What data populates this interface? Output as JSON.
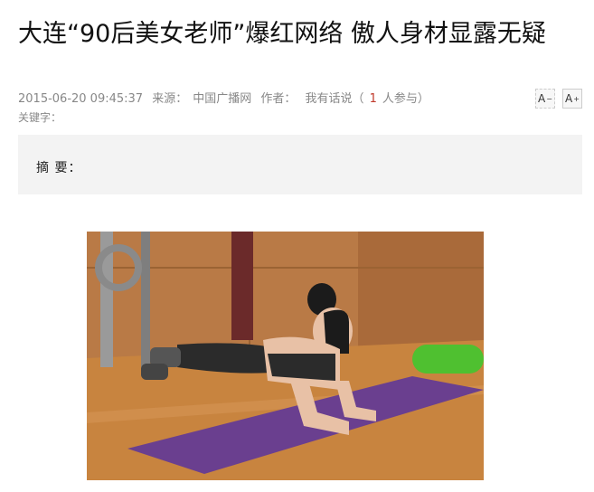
{
  "article": {
    "title": "大连“90后美女老师”爆红网络 傲人身材显露无疑",
    "date": "2015-06-20 09:45:37",
    "source_label": "来源：",
    "source": "中国广播网",
    "author_label": "作者：",
    "comments_prefix": "我有话说（",
    "comments_count": "1",
    "comments_suffix": "人参与）",
    "keywords_label": "关键字：",
    "summary_label": "摘 要："
  },
  "font_controls": {
    "decrease_label": "A",
    "decrease_mark": "−",
    "increase_label": "A",
    "increase_mark": "+"
  },
  "photo": {
    "icon": "photo-image",
    "colors": {
      "floor": "#c8843f",
      "wall": "#b97a46",
      "mat": "#6a3f8f",
      "roller": "#4fc030",
      "outfit": "#2b2b2b",
      "skin": "#e8c1a6"
    }
  }
}
